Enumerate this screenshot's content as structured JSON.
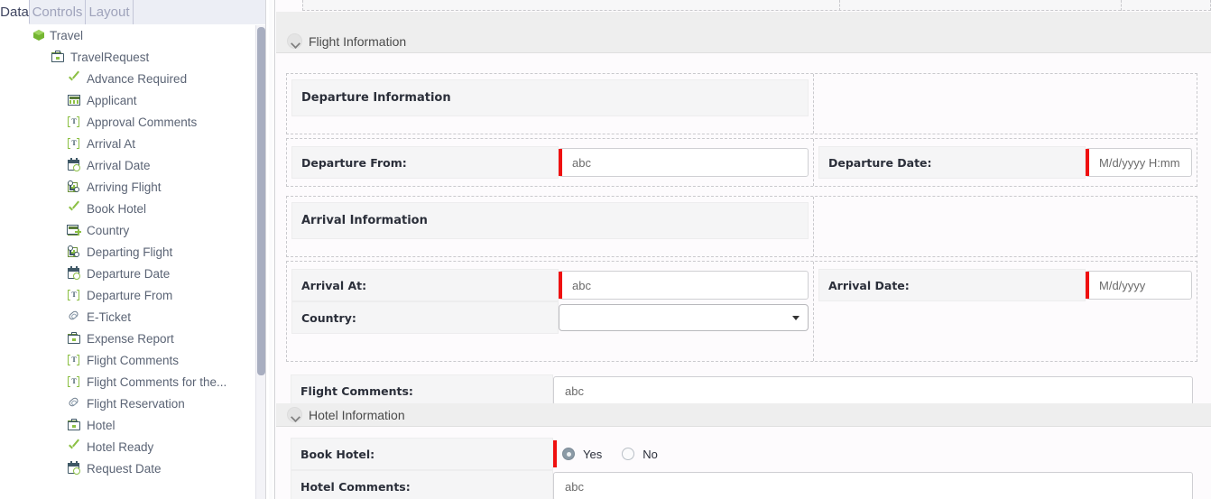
{
  "left_panel": {
    "tabs": [
      {
        "label": "Data",
        "active": true
      },
      {
        "label": "Controls",
        "active": false
      },
      {
        "label": "Layout",
        "active": false
      }
    ],
    "tree": [
      {
        "label": "Travel",
        "level": 0,
        "icon": "cube-icon",
        "expander": "none"
      },
      {
        "label": "TravelRequest",
        "level": 1,
        "icon": "briefcase-icon",
        "expander": "minus"
      },
      {
        "label": "Advance Required",
        "level": 2,
        "icon": "checkmark-icon",
        "expander": "none"
      },
      {
        "label": "Applicant",
        "level": 2,
        "icon": "grid-icon",
        "expander": "plus"
      },
      {
        "label": "Approval Comments",
        "level": 2,
        "icon": "textfield-icon",
        "expander": "none"
      },
      {
        "label": "Arrival At",
        "level": 2,
        "icon": "textfield-icon",
        "expander": "none"
      },
      {
        "label": "Arrival Date",
        "level": 2,
        "icon": "datetime-icon",
        "expander": "none"
      },
      {
        "label": "Arriving Flight",
        "level": 2,
        "icon": "relation-icon",
        "expander": "plus"
      },
      {
        "label": "Book Hotel",
        "level": 2,
        "icon": "checkmark-icon",
        "expander": "none"
      },
      {
        "label": "Country",
        "level": 2,
        "icon": "grid-plus-icon",
        "expander": "plus"
      },
      {
        "label": "Departing Flight",
        "level": 2,
        "icon": "relation-icon",
        "expander": "plus"
      },
      {
        "label": "Departure Date",
        "level": 2,
        "icon": "datetime-icon",
        "expander": "none"
      },
      {
        "label": "Departure From",
        "level": 2,
        "icon": "textfield-icon",
        "expander": "none"
      },
      {
        "label": "E-Ticket",
        "level": 2,
        "icon": "paperclip-icon",
        "expander": "none"
      },
      {
        "label": "Expense Report",
        "level": 2,
        "icon": "briefcase-icon",
        "expander": "plus"
      },
      {
        "label": "Flight Comments",
        "level": 2,
        "icon": "textfield-icon",
        "expander": "none"
      },
      {
        "label": "Flight Comments for the...",
        "level": 2,
        "icon": "textfield-icon",
        "expander": "none"
      },
      {
        "label": "Flight Reservation",
        "level": 2,
        "icon": "paperclip-icon",
        "expander": "none"
      },
      {
        "label": "Hotel",
        "level": 2,
        "icon": "briefcase-icon",
        "expander": "plus"
      },
      {
        "label": "Hotel Ready",
        "level": 2,
        "icon": "checkmark-icon",
        "expander": "none"
      },
      {
        "label": "Request Date",
        "level": 2,
        "icon": "datetime-icon",
        "expander": "none"
      }
    ]
  },
  "form": {
    "sections": [
      {
        "title": "Flight Information",
        "collapse_icon": "chevron-down-icon",
        "groups": [
          {
            "header": "Departure Information",
            "rows": [
              {
                "label": "Departure From:",
                "control": "textbox",
                "value": "abc",
                "required": true
              },
              {
                "label": "Departure Date:",
                "control": "textbox",
                "value": "M/d/yyyy H:mm",
                "required": true
              }
            ]
          },
          {
            "header": "Arrival Information",
            "rows": [
              {
                "label": "Arrival At:",
                "control": "textbox",
                "value": "abc",
                "required": true
              },
              {
                "label": "Arrival Date:",
                "control": "textbox",
                "value": "M/d/yyyy",
                "required": true
              },
              {
                "label": "Country:",
                "control": "combobox",
                "value": "",
                "required": false,
                "dropdown_icon": "chevron-down-icon"
              }
            ]
          },
          {
            "header": "",
            "rows": [
              {
                "label": "Flight Comments:",
                "control": "textbox",
                "value": "abc",
                "required": false
              }
            ]
          }
        ]
      },
      {
        "title": "Hotel Information",
        "collapse_icon": "chevron-down-icon",
        "groups": [
          {
            "header": "",
            "rows": [
              {
                "label": "Book Hotel:",
                "control": "radiogroup",
                "required": true,
                "options": [
                  {
                    "label": "Yes",
                    "selected": true
                  },
                  {
                    "label": "No",
                    "selected": false
                  }
                ]
              },
              {
                "label": "Hotel Comments:",
                "control": "textbox",
                "value": "abc",
                "required": false
              }
            ]
          }
        ]
      }
    ]
  },
  "colors": {
    "required_marker": "#ef1010",
    "tree_accent_green": "#8cc044",
    "section_header_bg": "#eeeeee",
    "form_bg": "#fdfbfd",
    "label_cell_bg": "#f5f5f6"
  }
}
